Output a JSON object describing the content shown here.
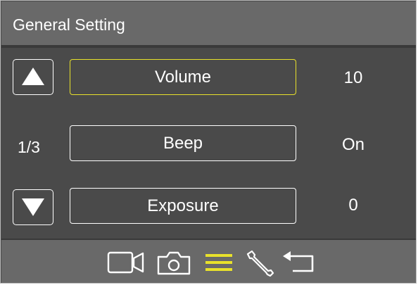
{
  "header": {
    "title": "General Setting"
  },
  "pager": {
    "indicator": "1/3",
    "up_icon": "arrow-up-icon",
    "down_icon": "arrow-down-icon"
  },
  "options": [
    {
      "label": "Volume",
      "value": "10",
      "selected": true
    },
    {
      "label": "Beep",
      "value": "On",
      "selected": false
    },
    {
      "label": "Exposure",
      "value": "0",
      "selected": false
    }
  ],
  "footer_icons": [
    "video-camera-icon",
    "photo-camera-icon",
    "menu-icon",
    "wrench-icon",
    "back-arrow-icon"
  ],
  "colors": {
    "background": "#4a4a4a",
    "bar": "#696969",
    "highlight": "#e8e12b",
    "text": "#ffffff"
  }
}
